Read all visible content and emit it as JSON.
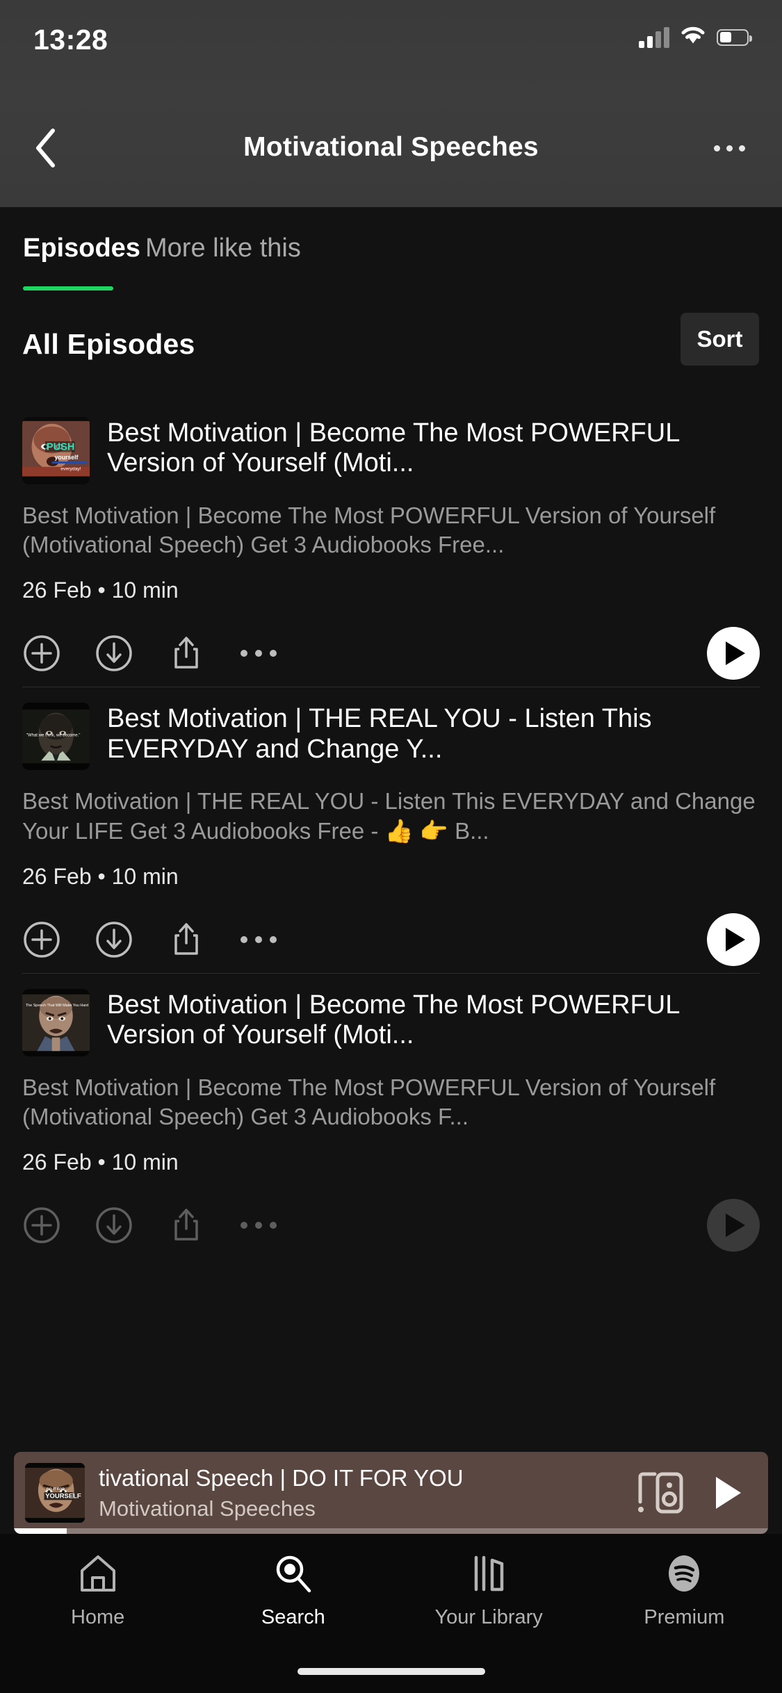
{
  "theme": {
    "background": "#121212",
    "header_gray": "#3a3a3a",
    "accent_green": "#1ED760",
    "nowplaying_bg": "#5a4741",
    "muted_text": "#9a9a9a",
    "nav_bg": "#0a0a0a"
  },
  "status_bar": {
    "time": "13:28",
    "cellular_icon": "cellular-signal-icon",
    "cellular_bars_filled": 2,
    "cellular_bars_total": 4,
    "wifi_icon": "wifi-icon",
    "battery_icon": "battery-icon",
    "battery_percent": 45
  },
  "header": {
    "back_icon": "chevron-left-icon",
    "title": "Motivational Speeches",
    "more_icon": "more-horizontal-icon"
  },
  "tabs": [
    {
      "label": "Episodes",
      "active": true
    },
    {
      "label": "More like this",
      "active": false
    }
  ],
  "section": {
    "title": "All Episodes",
    "sort_label": "Sort"
  },
  "episode_actions": {
    "add_icon": "plus-circle-icon",
    "download_icon": "download-circle-icon",
    "share_icon": "share-icon",
    "more_icon": "more-horizontal-icon",
    "play_icon": "play-icon"
  },
  "episodes": [
    {
      "title": "Best Motivation | Become The Most POWERFUL Version of Yourself (Moti...",
      "description": "Best Motivation | Become The Most POWERFUL Version of Yourself (Motivational Speech) Get 3 Audiobooks Free...",
      "date": "26 Feb",
      "separator": "•",
      "duration": "10 min",
      "meta": "26 Feb • 10 min",
      "thumbnail_alt": "Man shouting with PUSH yourself everyday! overlay",
      "thumbnail_caption_1": "PUSH",
      "thumbnail_caption_2": "yourself",
      "thumbnail_caption_3": "everyday!"
    },
    {
      "title": "Best Motivation | THE REAL YOU - Listen This EVERYDAY and Change Y...",
      "description": "Best Motivation | THE REAL YOU - Listen This EVERYDAY and Change Your LIFE Get 3 Audiobooks Free -  👍 👉 B...",
      "date": "26 Feb",
      "separator": "•",
      "duration": "10 min",
      "meta": "26 Feb • 10 min",
      "thumbnail_alt": "Dark portrait with quote overlay",
      "thumbnail_caption_1": "\"What we think, we become.\""
    },
    {
      "title": "Best Motivation | Become The Most POWERFUL Version of Yourself (Moti...",
      "description": "Best Motivation | Become The Most POWERFUL Version of Yourself (Motivational Speech) Get 3 Audiobooks F...",
      "date": "26 Feb",
      "separator": "•",
      "duration": "10 min",
      "meta": "26 Feb • 10 min",
      "thumbnail_alt": "Intense face, The Speech That Will Make You Hard",
      "thumbnail_caption_1": "The Speech That Will Make You Hard"
    }
  ],
  "now_playing": {
    "title": "tivational Speech | DO IT FOR YOU",
    "subtitle": "Motivational Speeches",
    "connect_icon": "connect-to-device-icon",
    "play_icon": "play-icon",
    "progress_percent": 7,
    "thumbnail_alt": "Man's face with DO IT FOR YOURSELF text",
    "thumbnail_caption_1": "DO IT FOR",
    "thumbnail_caption_2": "YOURSELF"
  },
  "bottom_nav": [
    {
      "label": "Home",
      "icon": "home-icon",
      "active": false
    },
    {
      "label": "Search",
      "icon": "search-icon",
      "active": true
    },
    {
      "label": "Your Library",
      "icon": "library-icon",
      "active": false
    },
    {
      "label": "Premium",
      "icon": "spotify-logo-icon",
      "active": false
    }
  ]
}
